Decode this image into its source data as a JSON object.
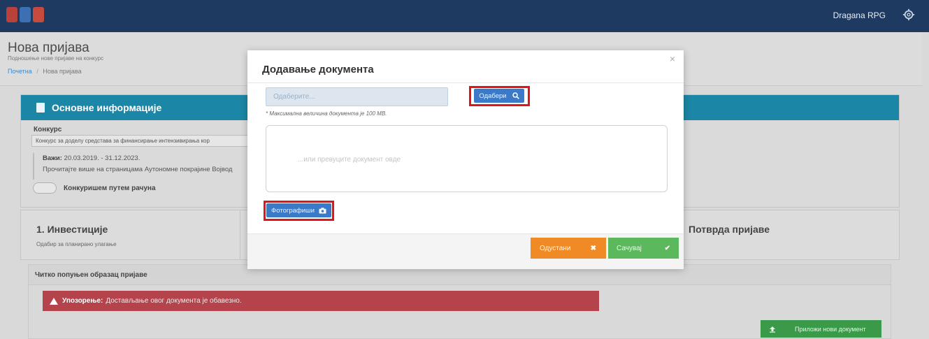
{
  "topbar": {
    "user_name": "Dragana RPG",
    "gear_icon": "gear-icon"
  },
  "header": {
    "title": "Нова пријава",
    "subtitle": "Подношење нове пријаве на конкурс",
    "breadcrumb": {
      "home": "Почетна",
      "separator": "/",
      "current": "Нова пријава"
    }
  },
  "info_panel": {
    "title": "Основне информације",
    "konkurs_label": "Конкурс",
    "konkurs_value": "Конкурс за доделу средстава за финансирање интензивирања кор",
    "valid_label": "Важи:",
    "valid_range": "20.03.2019. - 31.12.2023.",
    "more_text": "Прочитајте више на страницама Аутономне покрајине Војвод",
    "toggle_label": "Конкуришем путем рачуна"
  },
  "steps": {
    "step1_title": "1. Инвестиције",
    "step1_sub": "Одабир за планирано улагање",
    "confirm_title": "Потврда пријаве"
  },
  "doc_section": {
    "title": "Читко попуњен образац пријаве",
    "warning_label": "Упозорење:",
    "warning_text": "Достављање овог документа је обавезно.",
    "attach_label": "Приложи нови документ"
  },
  "modal": {
    "title": "Додавање документа",
    "close": "×",
    "file_placeholder": "Одаберите...",
    "choose_label": "Одабери",
    "max_note": "* Максимална величина документа је 100 MB.",
    "drop_text": "...или превуците документ овде",
    "photo_label": "Фотографиши",
    "cancel_label": "Одустани",
    "save_label": "Сачувај"
  },
  "colors": {
    "topbar": "#1f3a60",
    "info_header": "#1c86a6",
    "primary_button": "#3b7ac8",
    "cancel_button": "#f08a24",
    "save_button": "#5cb85c",
    "warning": "#b5434b",
    "highlight": "#e0141c"
  }
}
